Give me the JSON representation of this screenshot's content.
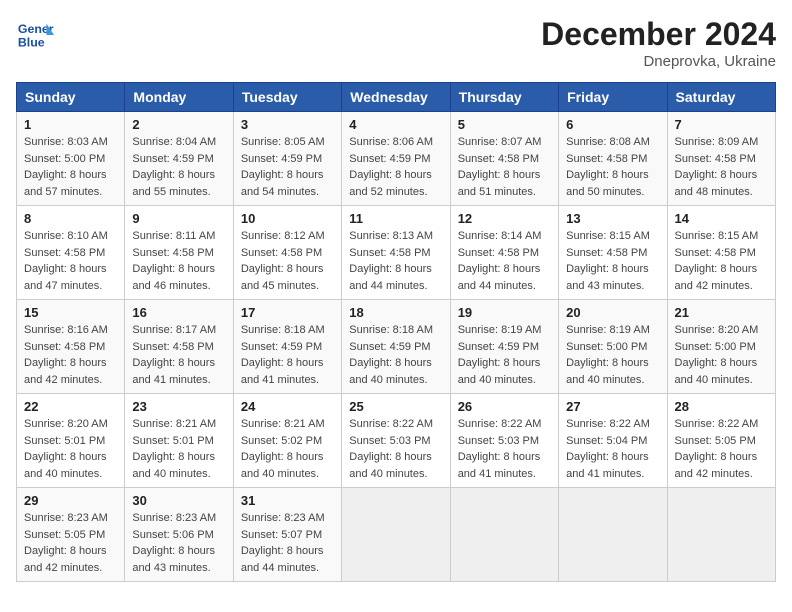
{
  "header": {
    "logo_text_general": "General",
    "logo_text_blue": "Blue",
    "title": "December 2024",
    "subtitle": "Dneprovka, Ukraine"
  },
  "weekdays": [
    "Sunday",
    "Monday",
    "Tuesday",
    "Wednesday",
    "Thursday",
    "Friday",
    "Saturday"
  ],
  "weeks": [
    [
      {
        "day": "1",
        "info": "Sunrise: 8:03 AM\nSunset: 5:00 PM\nDaylight: 8 hours\nand 57 minutes."
      },
      {
        "day": "2",
        "info": "Sunrise: 8:04 AM\nSunset: 4:59 PM\nDaylight: 8 hours\nand 55 minutes."
      },
      {
        "day": "3",
        "info": "Sunrise: 8:05 AM\nSunset: 4:59 PM\nDaylight: 8 hours\nand 54 minutes."
      },
      {
        "day": "4",
        "info": "Sunrise: 8:06 AM\nSunset: 4:59 PM\nDaylight: 8 hours\nand 52 minutes."
      },
      {
        "day": "5",
        "info": "Sunrise: 8:07 AM\nSunset: 4:58 PM\nDaylight: 8 hours\nand 51 minutes."
      },
      {
        "day": "6",
        "info": "Sunrise: 8:08 AM\nSunset: 4:58 PM\nDaylight: 8 hours\nand 50 minutes."
      },
      {
        "day": "7",
        "info": "Sunrise: 8:09 AM\nSunset: 4:58 PM\nDaylight: 8 hours\nand 48 minutes."
      }
    ],
    [
      {
        "day": "8",
        "info": "Sunrise: 8:10 AM\nSunset: 4:58 PM\nDaylight: 8 hours\nand 47 minutes."
      },
      {
        "day": "9",
        "info": "Sunrise: 8:11 AM\nSunset: 4:58 PM\nDaylight: 8 hours\nand 46 minutes."
      },
      {
        "day": "10",
        "info": "Sunrise: 8:12 AM\nSunset: 4:58 PM\nDaylight: 8 hours\nand 45 minutes."
      },
      {
        "day": "11",
        "info": "Sunrise: 8:13 AM\nSunset: 4:58 PM\nDaylight: 8 hours\nand 44 minutes."
      },
      {
        "day": "12",
        "info": "Sunrise: 8:14 AM\nSunset: 4:58 PM\nDaylight: 8 hours\nand 44 minutes."
      },
      {
        "day": "13",
        "info": "Sunrise: 8:15 AM\nSunset: 4:58 PM\nDaylight: 8 hours\nand 43 minutes."
      },
      {
        "day": "14",
        "info": "Sunrise: 8:15 AM\nSunset: 4:58 PM\nDaylight: 8 hours\nand 42 minutes."
      }
    ],
    [
      {
        "day": "15",
        "info": "Sunrise: 8:16 AM\nSunset: 4:58 PM\nDaylight: 8 hours\nand 42 minutes."
      },
      {
        "day": "16",
        "info": "Sunrise: 8:17 AM\nSunset: 4:58 PM\nDaylight: 8 hours\nand 41 minutes."
      },
      {
        "day": "17",
        "info": "Sunrise: 8:18 AM\nSunset: 4:59 PM\nDaylight: 8 hours\nand 41 minutes."
      },
      {
        "day": "18",
        "info": "Sunrise: 8:18 AM\nSunset: 4:59 PM\nDaylight: 8 hours\nand 40 minutes."
      },
      {
        "day": "19",
        "info": "Sunrise: 8:19 AM\nSunset: 4:59 PM\nDaylight: 8 hours\nand 40 minutes."
      },
      {
        "day": "20",
        "info": "Sunrise: 8:19 AM\nSunset: 5:00 PM\nDaylight: 8 hours\nand 40 minutes."
      },
      {
        "day": "21",
        "info": "Sunrise: 8:20 AM\nSunset: 5:00 PM\nDaylight: 8 hours\nand 40 minutes."
      }
    ],
    [
      {
        "day": "22",
        "info": "Sunrise: 8:20 AM\nSunset: 5:01 PM\nDaylight: 8 hours\nand 40 minutes."
      },
      {
        "day": "23",
        "info": "Sunrise: 8:21 AM\nSunset: 5:01 PM\nDaylight: 8 hours\nand 40 minutes."
      },
      {
        "day": "24",
        "info": "Sunrise: 8:21 AM\nSunset: 5:02 PM\nDaylight: 8 hours\nand 40 minutes."
      },
      {
        "day": "25",
        "info": "Sunrise: 8:22 AM\nSunset: 5:03 PM\nDaylight: 8 hours\nand 40 minutes."
      },
      {
        "day": "26",
        "info": "Sunrise: 8:22 AM\nSunset: 5:03 PM\nDaylight: 8 hours\nand 41 minutes."
      },
      {
        "day": "27",
        "info": "Sunrise: 8:22 AM\nSunset: 5:04 PM\nDaylight: 8 hours\nand 41 minutes."
      },
      {
        "day": "28",
        "info": "Sunrise: 8:22 AM\nSunset: 5:05 PM\nDaylight: 8 hours\nand 42 minutes."
      }
    ],
    [
      {
        "day": "29",
        "info": "Sunrise: 8:23 AM\nSunset: 5:05 PM\nDaylight: 8 hours\nand 42 minutes."
      },
      {
        "day": "30",
        "info": "Sunrise: 8:23 AM\nSunset: 5:06 PM\nDaylight: 8 hours\nand 43 minutes."
      },
      {
        "day": "31",
        "info": "Sunrise: 8:23 AM\nSunset: 5:07 PM\nDaylight: 8 hours\nand 44 minutes."
      },
      {
        "day": "",
        "info": ""
      },
      {
        "day": "",
        "info": ""
      },
      {
        "day": "",
        "info": ""
      },
      {
        "day": "",
        "info": ""
      }
    ]
  ]
}
